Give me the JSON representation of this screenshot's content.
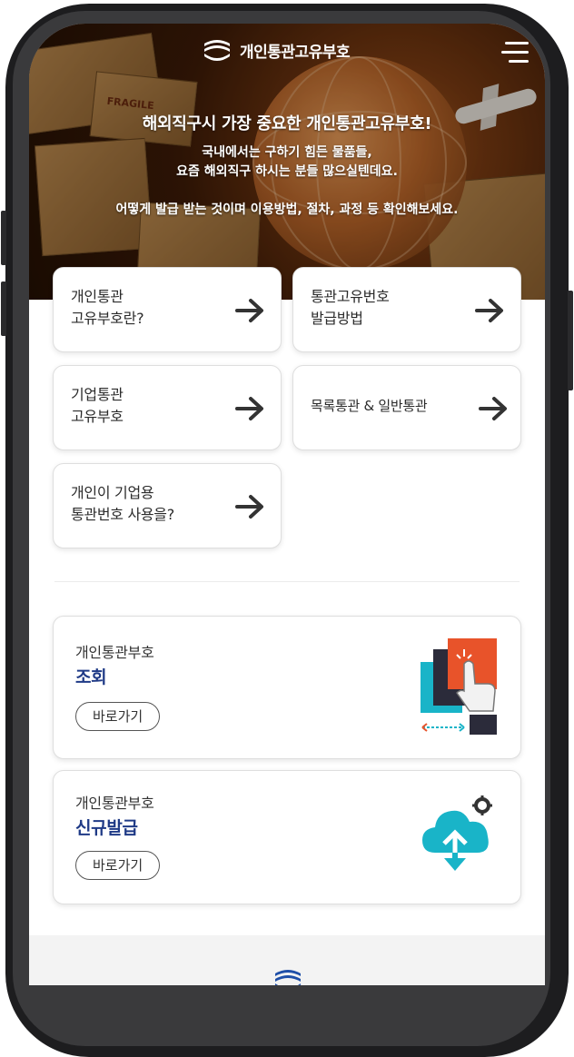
{
  "header": {
    "logo_text": "개인통관고유부호"
  },
  "hero": {
    "headline": "해외직구시 가장 중요한 개인통관고유부호!",
    "sub_line_1": "국내에서는 구하기 힘든 물품들,",
    "sub_line_2": "요즘 해외직구 하시는 분들 많으실텐데요.",
    "sub_line_3": "어떻게 발급 받는 것이며 이용방법, 절차, 과정 등 확인해보세요.",
    "box_stamp": "FRAGILE"
  },
  "menu_cards": [
    {
      "line1": "개인통관",
      "line2": "고유부호란?"
    },
    {
      "line1": "통관고유번호",
      "line2": "발급방법"
    },
    {
      "line1": "기업통관",
      "line2": "고유부호"
    },
    {
      "line1": "목록통관 & 일반통관",
      "line2": ""
    },
    {
      "line1": "개인이 기업용",
      "line2": "통관번호 사용을?"
    }
  ],
  "link_cards": [
    {
      "small": "개인통관부호",
      "big": "조회",
      "button": "바로가기",
      "icon": "touch-screen-icon"
    },
    {
      "small": "개인통관부호",
      "big": "신규발급",
      "button": "바로가기",
      "icon": "cloud-upload-icon"
    }
  ],
  "colors": {
    "accent_blue": "#1f3a86",
    "icon_teal": "#19b4c8",
    "icon_orange": "#e8532a"
  }
}
